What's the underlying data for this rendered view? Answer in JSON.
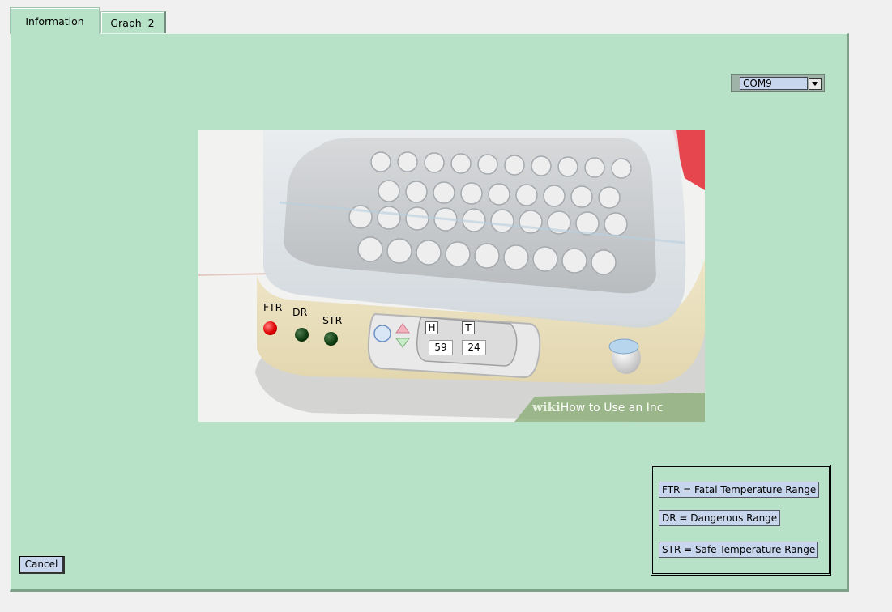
{
  "tabs": [
    {
      "label": "Information",
      "active": true
    },
    {
      "label": "Graph  2",
      "active": false
    }
  ],
  "com_select": {
    "value": "COM9"
  },
  "indicators": {
    "ftr": {
      "label": "FTR",
      "color": "#e00000"
    },
    "dr": {
      "label": "DR",
      "color": "#0d3a10"
    },
    "str": {
      "label": "STR",
      "color": "#0d3a10"
    }
  },
  "readings": {
    "humidity": {
      "label": "H",
      "value": "59"
    },
    "temperature": {
      "label": "T",
      "value": "24"
    }
  },
  "watermark": {
    "brand": "wiki",
    "text": "How to Use an Inc"
  },
  "legend": [
    {
      "text": "FTR = Fatal Temperature Range"
    },
    {
      "text": "DR = Dangerous Range"
    },
    {
      "text": "STR = Safe Temperature Range"
    }
  ],
  "cancel_label": "Cancel",
  "colors": {
    "panel": "#b8e2c8",
    "field": "#c7d6ec"
  }
}
